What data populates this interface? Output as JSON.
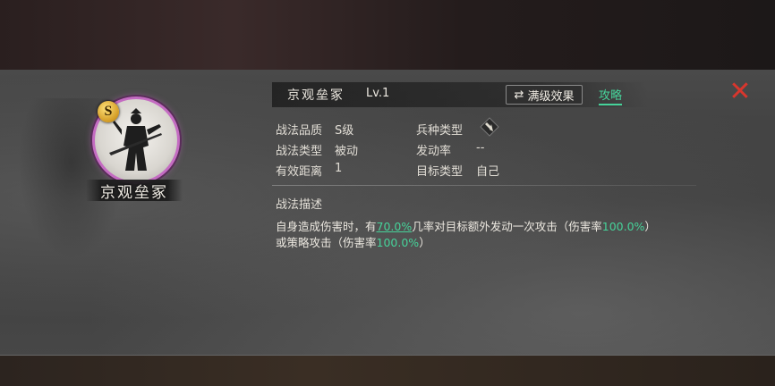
{
  "skill": {
    "name": "京观垒冢",
    "level": "Lv.1",
    "grade_badge": "S",
    "max_effect_label": "满级效果",
    "max_effect_icon": "swap-arrows-icon",
    "guide_label": "攻略",
    "close_icon": "close-x-icon"
  },
  "attributes": {
    "quality_label": "战法品质",
    "quality_value": "S级",
    "troop_type_label": "兵种类型",
    "type_label": "战法类型",
    "type_value": "被动",
    "trigger_rate_label": "发动率",
    "trigger_rate_value": "--",
    "range_label": "有效距离",
    "range_value": "1",
    "target_label": "目标类型",
    "target_value": "自己"
  },
  "description": {
    "title": "战法描述",
    "seg1": "自身造成伤害时，有",
    "rate": "70.0%",
    "seg2": "几率对目标额外发动一次攻击（伤害率",
    "dmg1": "100.0%",
    "seg3": "）",
    "seg4": "或策略攻击（伤害率",
    "dmg2": "100.0%",
    "seg5": "）"
  },
  "colors": {
    "accent_green": "#46d39a",
    "close_red": "#d8362d",
    "portrait_ring": "#c46bc2",
    "badge_gold": "#d29a22"
  }
}
